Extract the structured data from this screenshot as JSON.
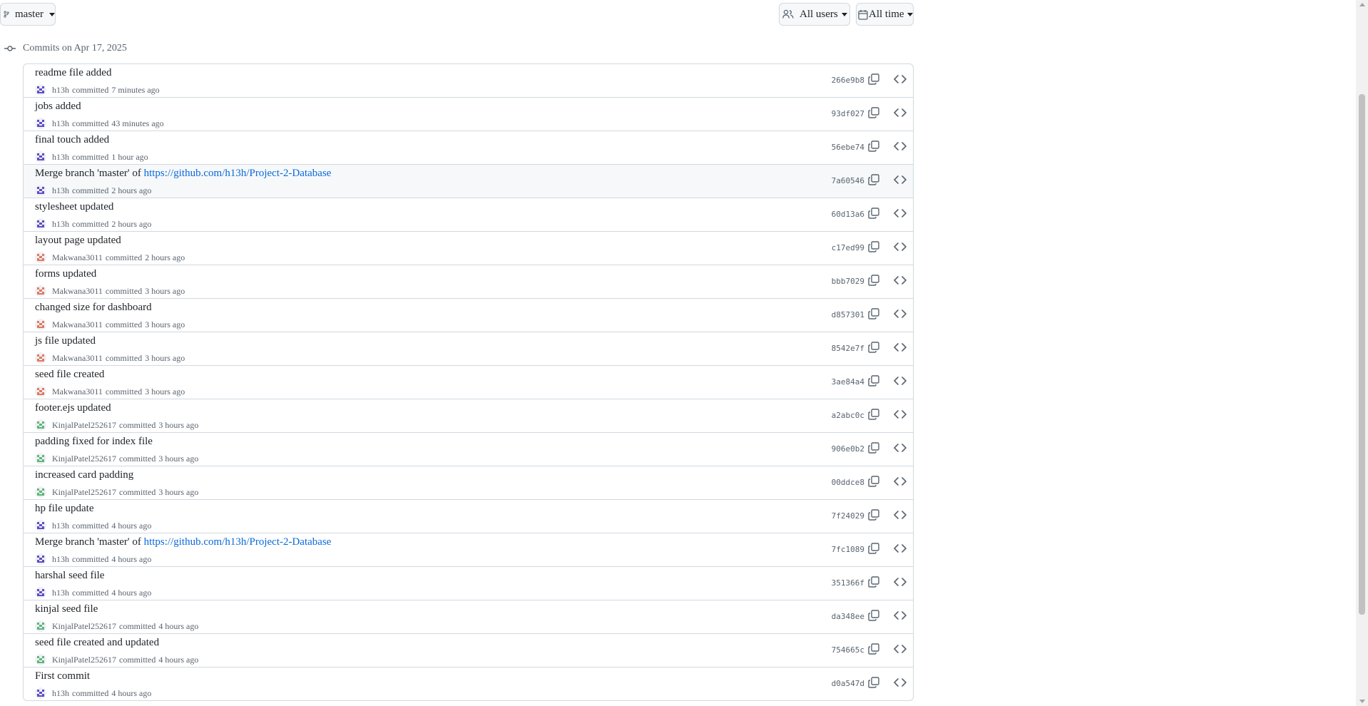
{
  "toolbar": {
    "branch_label": "master",
    "users_label": "All users",
    "time_label": "All time"
  },
  "commits_heading": "Commits on Apr 17, 2025",
  "colors": {
    "link": "#0969da",
    "border": "#d1d9e0",
    "muted": "#59636e",
    "avatar_h13h": "#5b4fc4",
    "avatar_makwana": "#e07a5f",
    "avatar_kinjal": "#5cb87a"
  },
  "commits": [
    {
      "message": "readme file added",
      "link": "",
      "author": "h13h",
      "avatar": "purple",
      "action": "committed",
      "time": "7 minutes ago",
      "sha": "266e9b8"
    },
    {
      "message": "jobs added",
      "link": "",
      "author": "h13h",
      "avatar": "purple",
      "action": "committed",
      "time": "43 minutes ago",
      "sha": "93df027"
    },
    {
      "message": "final touch added",
      "link": "",
      "author": "h13h",
      "avatar": "purple",
      "action": "committed",
      "time": "1 hour ago",
      "sha": "56ebe74"
    },
    {
      "message": "Merge branch 'master' of ",
      "link": "https://github.com/h13h/Project-2-Database",
      "author": "h13h",
      "avatar": "purple",
      "action": "committed",
      "time": "2 hours ago",
      "sha": "7a60546",
      "highlighted": true
    },
    {
      "message": "stylesheet updated",
      "link": "",
      "author": "h13h",
      "avatar": "purple",
      "action": "committed",
      "time": "2 hours ago",
      "sha": "60d13a6"
    },
    {
      "message": "layout page updated",
      "link": "",
      "author": "Makwana3011",
      "avatar": "orange",
      "action": "committed",
      "time": "2 hours ago",
      "sha": "c17ed99"
    },
    {
      "message": "forms updated",
      "link": "",
      "author": "Makwana3011",
      "avatar": "orange",
      "action": "committed",
      "time": "3 hours ago",
      "sha": "bbb7029"
    },
    {
      "message": "changed size for dashboard",
      "link": "",
      "author": "Makwana3011",
      "avatar": "orange",
      "action": "committed",
      "time": "3 hours ago",
      "sha": "d857301"
    },
    {
      "message": "js file updated",
      "link": "",
      "author": "Makwana3011",
      "avatar": "orange",
      "action": "committed",
      "time": "3 hours ago",
      "sha": "8542e7f"
    },
    {
      "message": "seed file created",
      "link": "",
      "author": "Makwana3011",
      "avatar": "orange",
      "action": "committed",
      "time": "3 hours ago",
      "sha": "3ae84a4"
    },
    {
      "message": "footer.ejs updated",
      "link": "",
      "author": "KinjalPatel252617",
      "avatar": "green",
      "action": "committed",
      "time": "3 hours ago",
      "sha": "a2abc0c"
    },
    {
      "message": "padding fixed for index file",
      "link": "",
      "author": "KinjalPatel252617",
      "avatar": "green",
      "action": "committed",
      "time": "3 hours ago",
      "sha": "906e0b2"
    },
    {
      "message": "increased card padding",
      "link": "",
      "author": "KinjalPatel252617",
      "avatar": "green",
      "action": "committed",
      "time": "3 hours ago",
      "sha": "00ddce8"
    },
    {
      "message": "hp file update",
      "link": "",
      "author": "h13h",
      "avatar": "purple",
      "action": "committed",
      "time": "4 hours ago",
      "sha": "7f24029"
    },
    {
      "message": "Merge branch 'master' of ",
      "link": "https://github.com/h13h/Project-2-Database",
      "author": "h13h",
      "avatar": "purple",
      "action": "committed",
      "time": "4 hours ago",
      "sha": "7fc1089"
    },
    {
      "message": "harshal seed file",
      "link": "",
      "author": "h13h",
      "avatar": "purple",
      "action": "committed",
      "time": "4 hours ago",
      "sha": "351366f"
    },
    {
      "message": "kinjal seed file",
      "link": "",
      "author": "KinjalPatel252617",
      "avatar": "green",
      "action": "committed",
      "time": "4 hours ago",
      "sha": "da348ee"
    },
    {
      "message": "seed file created and updated",
      "link": "",
      "author": "KinjalPatel252617",
      "avatar": "green",
      "action": "committed",
      "time": "4 hours ago",
      "sha": "754665c"
    },
    {
      "message": "First commit",
      "link": "",
      "author": "h13h",
      "avatar": "purple",
      "action": "committed",
      "time": "4 hours ago",
      "sha": "d0a547d"
    }
  ]
}
